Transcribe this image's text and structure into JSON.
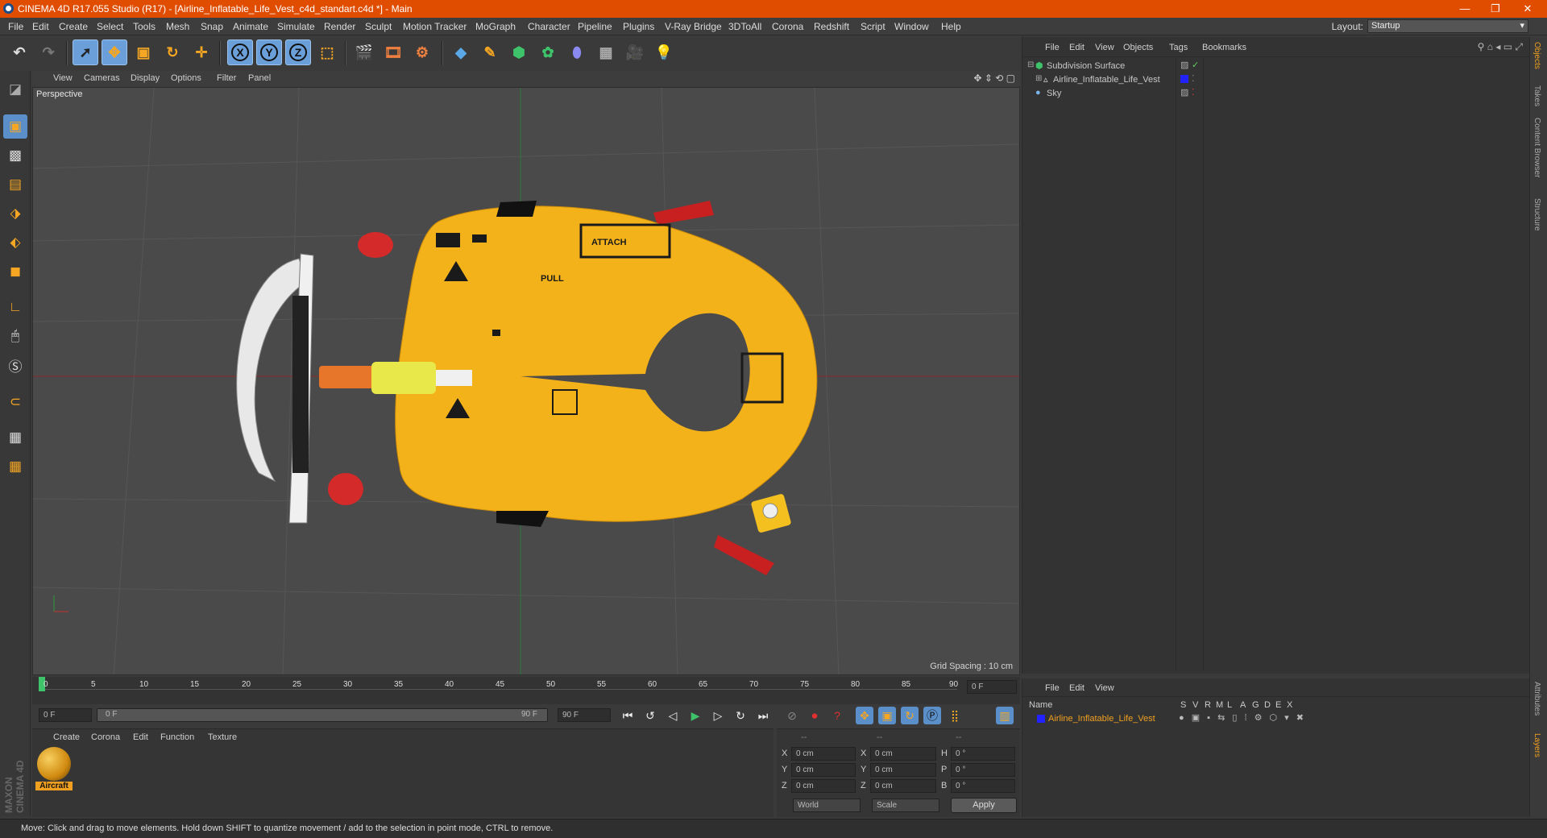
{
  "window": {
    "title": "CINEMA 4D R17.055 Studio (R17) - [Airline_Inflatable_Life_Vest_c4d_standart.c4d *] - Main",
    "minimize": "—",
    "maximize": "❐",
    "close": "✕"
  },
  "menubar": {
    "items": [
      "File",
      "Edit",
      "Create",
      "Select",
      "Tools",
      "Mesh",
      "Snap",
      "Animate",
      "Simulate",
      "Render",
      "Sculpt",
      "Motion Tracker",
      "MoGraph",
      "Character",
      "Pipeline",
      "Plugins",
      "V-Ray Bridge",
      "3DToAll",
      "Corona",
      "Redshift",
      "Script",
      "Window",
      "Help"
    ],
    "layout_label": "Layout:",
    "layout_value": "Startup"
  },
  "toolbar": {
    "axis_x": "X",
    "axis_y": "Y",
    "axis_z": "Z"
  },
  "viewport": {
    "menu": [
      "View",
      "Cameras",
      "Display",
      "Options",
      "Filter",
      "Panel"
    ],
    "label": "Perspective",
    "grid_spacing": "Grid Spacing : 10 cm",
    "accent_red": "#c83232",
    "accent_green": "#2e9a3a",
    "vest_text_1": "ATTACH",
    "vest_text_2": "PULL"
  },
  "timeline": {
    "ticks": [
      "0",
      "5",
      "10",
      "15",
      "20",
      "25",
      "30",
      "35",
      "40",
      "45",
      "50",
      "55",
      "60",
      "65",
      "70",
      "75",
      "80",
      "85",
      "90"
    ],
    "current_frame": "0 F"
  },
  "timecontrols": {
    "start_field": "0 F",
    "slider_start": "0 F",
    "slider_end": "90 F",
    "end_field": "90 F"
  },
  "material_manager": {
    "menu": [
      "Create",
      "Corona",
      "Edit",
      "Function",
      "Texture"
    ],
    "material_name": "Aircraft"
  },
  "coordinates": {
    "header": [
      "--",
      "--",
      "--"
    ],
    "rows": [
      {
        "axis": "X",
        "pos": "0 cm",
        "axis2": "X",
        "size": "0 cm",
        "rot_label": "H",
        "rot": "0 °"
      },
      {
        "axis": "Y",
        "pos": "0 cm",
        "axis2": "Y",
        "size": "0 cm",
        "rot_label": "P",
        "rot": "0 °"
      },
      {
        "axis": "Z",
        "pos": "0 cm",
        "axis2": "Z",
        "size": "0 cm",
        "rot_label": "B",
        "rot": "0 °"
      }
    ],
    "mode_world": "World",
    "mode_scale": "Scale",
    "apply": "Apply"
  },
  "object_manager": {
    "menu": [
      "File",
      "Edit",
      "View",
      "Objects",
      "Tags",
      "Bookmarks"
    ],
    "objects": [
      {
        "name": "Subdivision Surface",
        "color": "#5fd35f"
      },
      {
        "name": "Airline_Inflatable_Life_Vest",
        "color": "#dddddd"
      },
      {
        "name": "Sky",
        "color": "#dddddd"
      }
    ]
  },
  "layer_manager": {
    "menu": [
      "File",
      "Edit",
      "View"
    ],
    "col_name": "Name",
    "cols": [
      "S",
      "V",
      "R",
      "M",
      "L",
      "A",
      "G",
      "D",
      "E",
      "X"
    ],
    "layer_name": "Airline_Inflatable_Life_Vest",
    "layer_color": "#f0a020"
  },
  "right_tabs": [
    "Objects",
    "Takes",
    "Content Browser",
    "Structure",
    "Attributes",
    "Layers"
  ],
  "maxon_logo": "MAXON CINEMA 4D",
  "status": "Move: Click and drag to move elements. Hold down SHIFT to quantize movement / add to the selection in point mode, CTRL to remove."
}
